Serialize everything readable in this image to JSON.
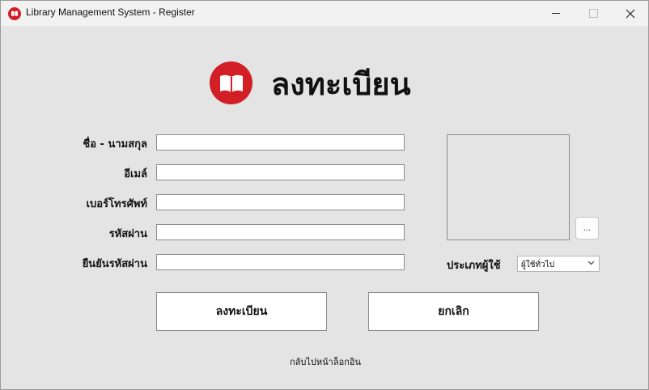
{
  "window": {
    "title": "Library Management System - Register"
  },
  "header": {
    "title": "ลงทะเบียน"
  },
  "form": {
    "fullname_label": "ชื่อ - นามสกุล",
    "email_label": "อีเมล์",
    "phone_label": "เบอร์โทรศัพท์",
    "password_label": "รหัสผ่าน",
    "confirm_label": "ยืนยันรหัสผ่าน",
    "fullname_value": "",
    "email_value": "",
    "phone_value": "",
    "password_value": "",
    "confirm_value": ""
  },
  "photo": {
    "browse_label": "..."
  },
  "user_type": {
    "label": "ประเภทผู้ใช้",
    "selected": "ผู้ใช้ทั่วไป"
  },
  "actions": {
    "register_label": "ลงทะเบียน",
    "cancel_label": "ยกเลิก"
  },
  "footer": {
    "back_link": "กลับไปหน้าล็อกอิน"
  },
  "colors": {
    "brand_red": "#d21f26"
  },
  "icons": {
    "app": "book-icon",
    "logo": "book-icon"
  }
}
